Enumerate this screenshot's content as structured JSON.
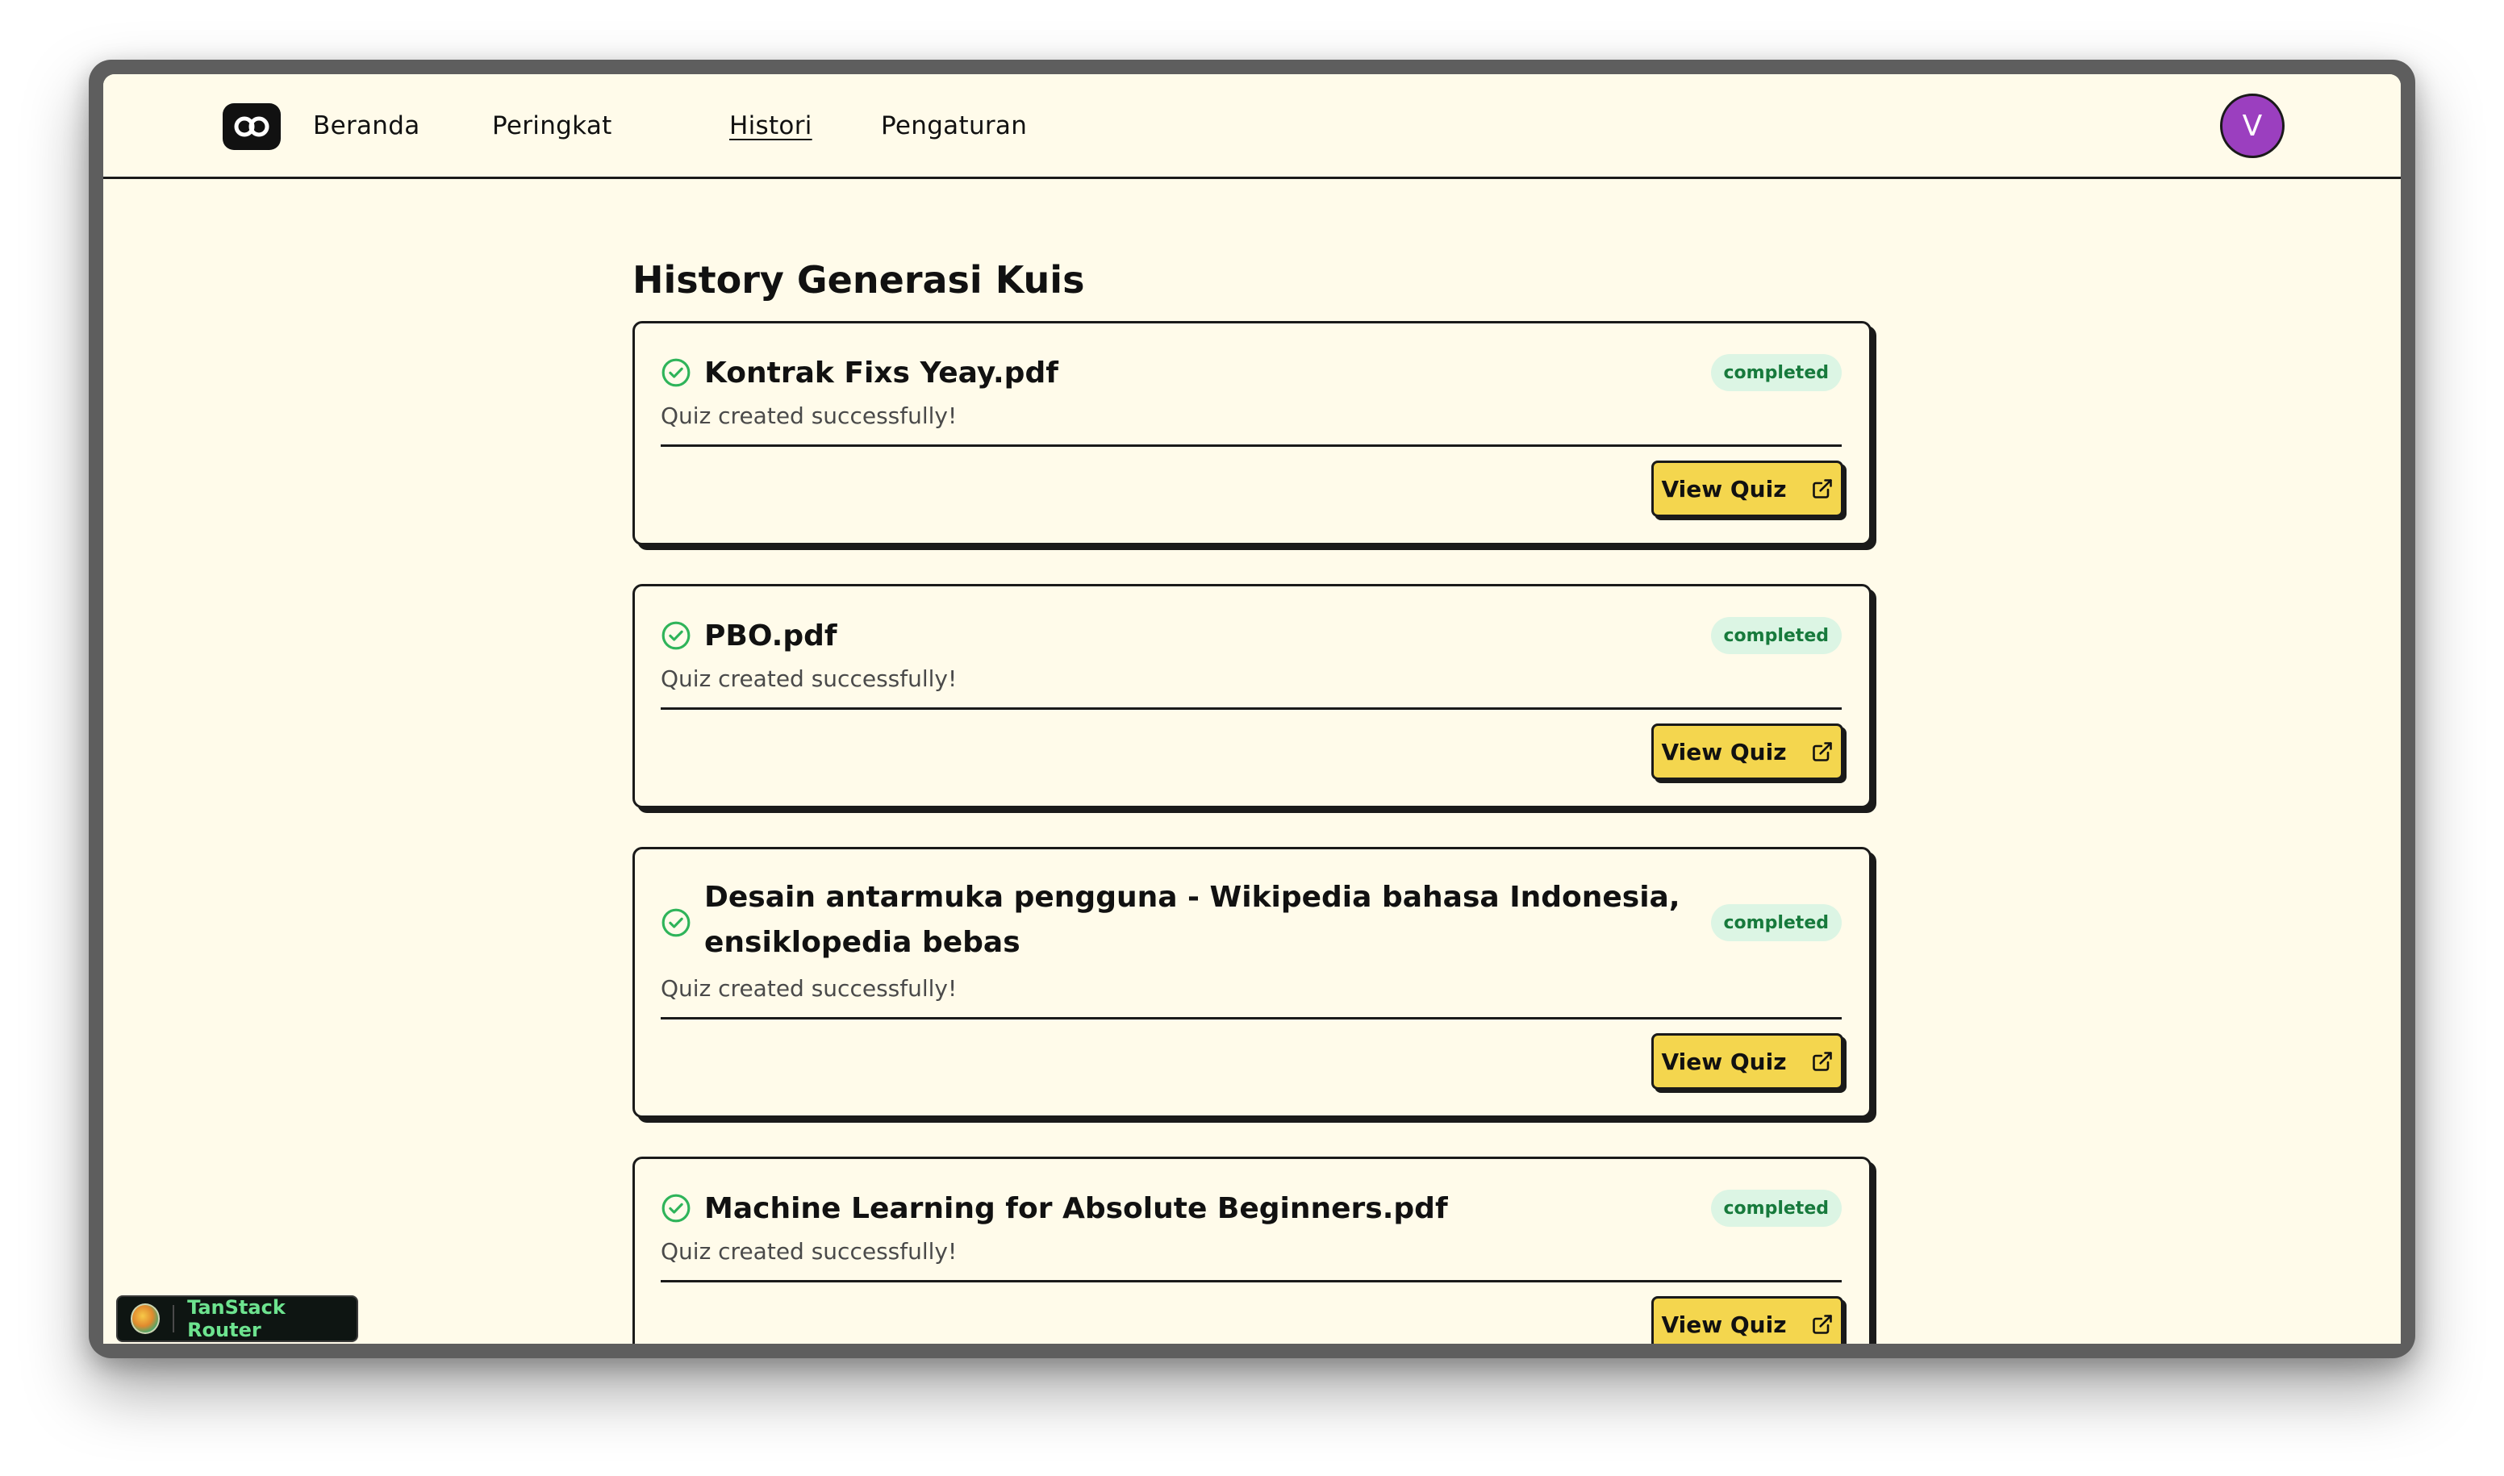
{
  "navbar": {
    "links": [
      "Beranda",
      "Peringkat",
      "Histori",
      "Pengaturan"
    ],
    "active": "Histori",
    "avatar_initial": "V"
  },
  "page": {
    "title": "History Generasi Kuis"
  },
  "items": [
    {
      "title": "Kontrak Fixs Yeay.pdf",
      "status": "completed",
      "message": "Quiz created successfully!",
      "button": "View Quiz"
    },
    {
      "title": "PBO.pdf",
      "status": "completed",
      "message": "Quiz created successfully!",
      "button": "View Quiz"
    },
    {
      "title": "Desain antarmuka pengguna - Wikipedia bahasa Indonesia, ensiklopedia bebas",
      "status": "completed",
      "message": "Quiz created successfully!",
      "button": "View Quiz"
    },
    {
      "title": "Machine Learning for Absolute Beginners.pdf",
      "status": "completed",
      "message": "Quiz created successfully!",
      "button": "View Quiz"
    }
  ],
  "devtools": {
    "label": "TanStack Router"
  },
  "colors": {
    "background": "#fffbea",
    "accent_button": "#f4d64e",
    "badge_bg": "#dcf5e4",
    "badge_text": "#177a3c",
    "check_icon": "#2fb45a",
    "avatar": "#9b3fbf"
  }
}
